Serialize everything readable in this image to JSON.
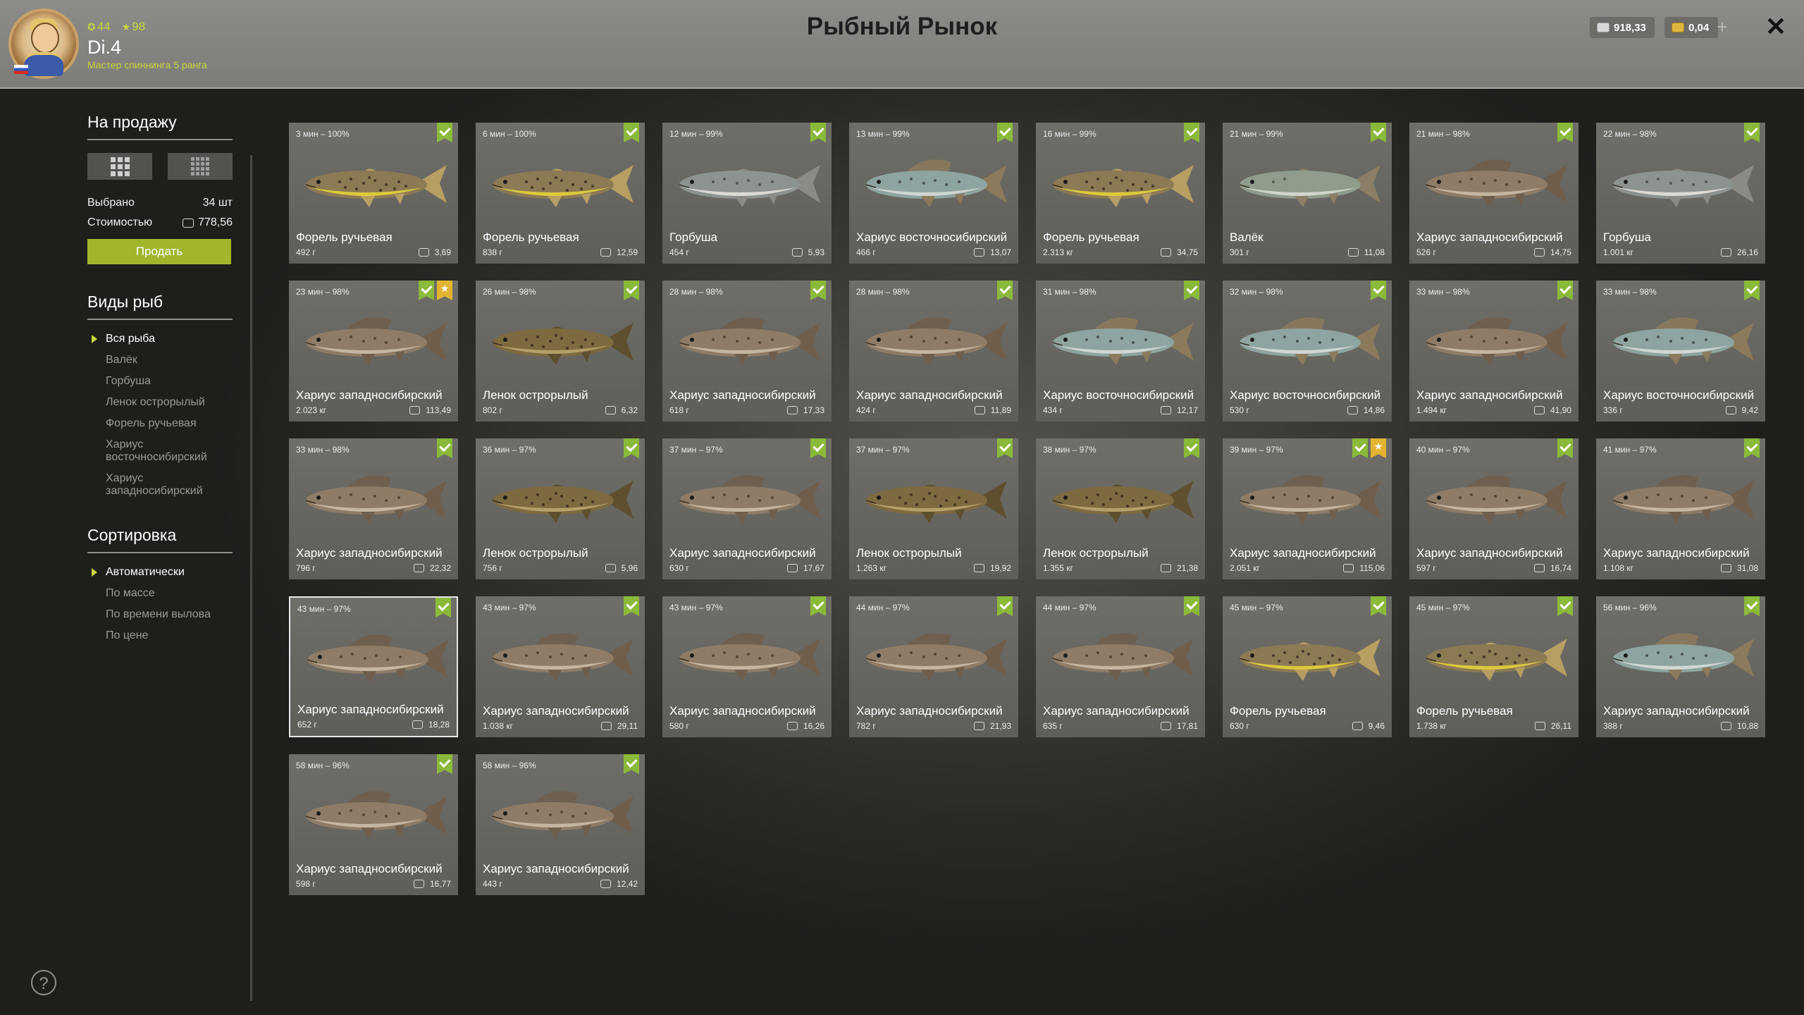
{
  "header": {
    "title": "Рыбный Рынок",
    "player": {
      "level": "44",
      "stars": "98",
      "name": "Di.4",
      "rank": "Мастер спиннинга 5 ранга"
    },
    "silver": "918,33",
    "gold": "0,04",
    "plus_label": "+",
    "close_label": "✕"
  },
  "sidebar": {
    "for_sale_title": "На продажу",
    "selected_label": "Выбрано",
    "selected_value": "34 шт",
    "cost_label": "Стоимостью",
    "cost_value": "778,56",
    "sell_label": "Продать",
    "species_title": "Виды рыб",
    "species": [
      "Вся рыба",
      "Валёк",
      "Горбуша",
      "Ленок острорылый",
      "Форель ручьевая",
      "Хариус восточносибирский",
      "Хариус западносибирский"
    ],
    "sort_title": "Сортировка",
    "sort_options": [
      "Автоматически",
      "По массе",
      "По времени вылова",
      "По цене"
    ],
    "help_label": "?"
  },
  "colors": {
    "accent": "#a2b52c",
    "check": "#8bb93a",
    "star": "#e2b431"
  },
  "fish": [
    {
      "time": "3 мин – 100%",
      "name": "Форель ручьевая",
      "weight": "492 г",
      "price": "3,69",
      "type": "trout"
    },
    {
      "time": "6 мин – 100%",
      "name": "Форель ручьевая",
      "weight": "838 г",
      "price": "12,59",
      "type": "trout"
    },
    {
      "time": "12 мин – 99%",
      "name": "Горбуша",
      "weight": "454 г",
      "price": "5,93",
      "type": "salmon"
    },
    {
      "time": "13 мин – 99%",
      "name": "Хариус восточносибирский",
      "weight": "466 г",
      "price": "13,07",
      "type": "egrayling"
    },
    {
      "time": "16 мин – 99%",
      "name": "Форель ручьевая",
      "weight": "2.313 кг",
      "price": "34,75",
      "type": "trout"
    },
    {
      "time": "21 мин – 99%",
      "name": "Валёк",
      "weight": "301 г",
      "price": "11,08",
      "type": "valek"
    },
    {
      "time": "21 мин – 98%",
      "name": "Хариус западносибирский",
      "weight": "526 г",
      "price": "14,75",
      "type": "wgrayling"
    },
    {
      "time": "22 мин – 98%",
      "name": "Горбуша",
      "weight": "1.001 кг",
      "price": "26,16",
      "type": "salmon"
    },
    {
      "time": "23 мин – 98%",
      "name": "Хариус западносибирский",
      "weight": "2.023 кг",
      "price": "113,49",
      "type": "wgrayling",
      "star": true
    },
    {
      "time": "26 мин – 98%",
      "name": "Ленок острорылый",
      "weight": "802 г",
      "price": "6,32",
      "type": "lenok"
    },
    {
      "time": "28 мин – 98%",
      "name": "Хариус западносибирский",
      "weight": "618 г",
      "price": "17,33",
      "type": "wgrayling"
    },
    {
      "time": "28 мин – 98%",
      "name": "Хариус западносибирский",
      "weight": "424 г",
      "price": "11,89",
      "type": "wgrayling"
    },
    {
      "time": "31 мин – 98%",
      "name": "Хариус восточносибирский",
      "weight": "434 г",
      "price": "12,17",
      "type": "egrayling"
    },
    {
      "time": "32 мин – 98%",
      "name": "Хариус восточносибирский",
      "weight": "530 г",
      "price": "14,86",
      "type": "egrayling"
    },
    {
      "time": "33 мин – 98%",
      "name": "Хариус западносибирский",
      "weight": "1.494 кг",
      "price": "41,90",
      "type": "wgrayling"
    },
    {
      "time": "33 мин – 98%",
      "name": "Хариус восточносибирский",
      "weight": "336 г",
      "price": "9,42",
      "type": "egrayling"
    },
    {
      "time": "33 мин – 98%",
      "name": "Хариус западносибирский",
      "weight": "796 г",
      "price": "22,32",
      "type": "wgrayling"
    },
    {
      "time": "36 мин – 97%",
      "name": "Ленок острорылый",
      "weight": "756 г",
      "price": "5,96",
      "type": "lenok"
    },
    {
      "time": "37 мин – 97%",
      "name": "Хариус западносибирский",
      "weight": "630 г",
      "price": "17,67",
      "type": "wgrayling"
    },
    {
      "time": "37 мин – 97%",
      "name": "Ленок острорылый",
      "weight": "1.263 кг",
      "price": "19,92",
      "type": "lenok"
    },
    {
      "time": "38 мин – 97%",
      "name": "Ленок острорылый",
      "weight": "1.355 кг",
      "price": "21,38",
      "type": "lenok"
    },
    {
      "time": "39 мин – 97%",
      "name": "Хариус западносибирский",
      "weight": "2.051 кг",
      "price": "115,06",
      "type": "wgrayling",
      "star": true
    },
    {
      "time": "40 мин – 97%",
      "name": "Хариус западносибирский",
      "weight": "597 г",
      "price": "16,74",
      "type": "wgrayling"
    },
    {
      "time": "41 мин – 97%",
      "name": "Хариус западносибирский",
      "weight": "1.108 кг",
      "price": "31,08",
      "type": "wgrayling"
    },
    {
      "time": "43 мин – 97%",
      "name": "Хариус западносибирский",
      "weight": "652 г",
      "price": "18,28",
      "type": "wgrayling",
      "selected": true
    },
    {
      "time": "43 мин – 97%",
      "name": "Хариус западносибирский",
      "weight": "1.038 кг",
      "price": "29,11",
      "type": "wgrayling"
    },
    {
      "time": "43 мин – 97%",
      "name": "Хариус западносибирский",
      "weight": "580 г",
      "price": "16,26",
      "type": "wgrayling"
    },
    {
      "time": "44 мин – 97%",
      "name": "Хариус западносибирский",
      "weight": "782 г",
      "price": "21,93",
      "type": "wgrayling"
    },
    {
      "time": "44 мин – 97%",
      "name": "Хариус западносибирский",
      "weight": "635 г",
      "price": "17,81",
      "type": "wgrayling"
    },
    {
      "time": "45 мин – 97%",
      "name": "Форель ручьевая",
      "weight": "630 г",
      "price": "9,46",
      "type": "trout"
    },
    {
      "time": "45 мин – 97%",
      "name": "Форель ручьевая",
      "weight": "1.738 кг",
      "price": "26,11",
      "type": "trout"
    },
    {
      "time": "56 мин – 96%",
      "name": "Хариус западносибирский",
      "weight": "388 г",
      "price": "10,88",
      "type": "egrayling"
    },
    {
      "time": "58 мин – 96%",
      "name": "Хариус западносибирский",
      "weight": "598 г",
      "price": "16,77",
      "type": "wgrayling"
    },
    {
      "time": "58 мин – 96%",
      "name": "Хариус западносибирский",
      "weight": "443 г",
      "price": "12,42",
      "type": "wgrayling"
    }
  ]
}
